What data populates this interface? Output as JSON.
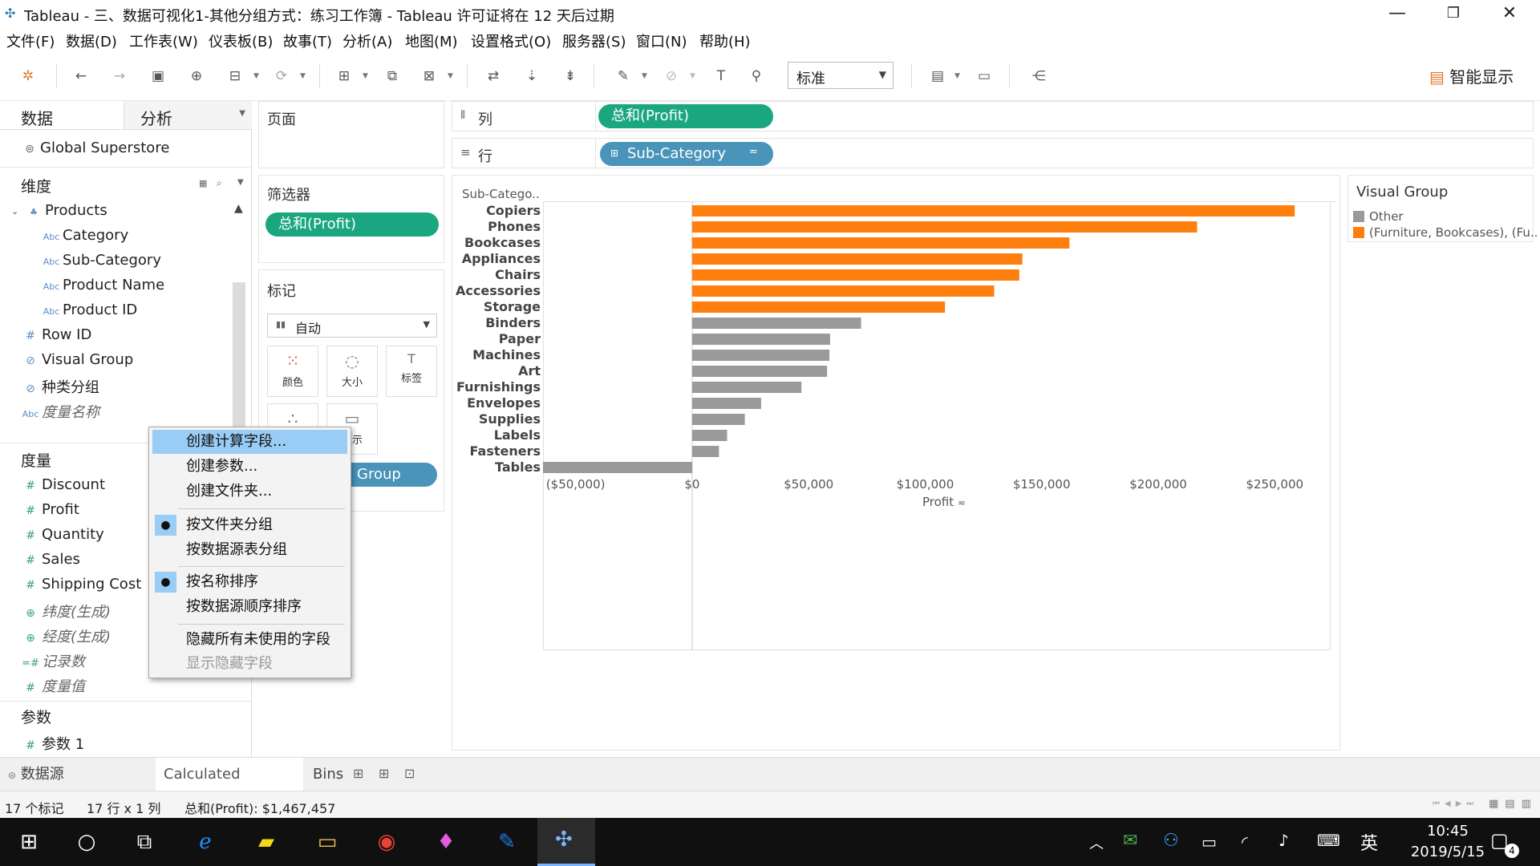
{
  "window": {
    "title": "Tableau - 三、数据可视化1-其他分组方式：练习工作簿 - Tableau 许可证将在 12 天后过期",
    "minimize": "—",
    "maximize": "❐",
    "close": "✕"
  },
  "menu": [
    "文件(F)",
    "数据(D)",
    "工作表(W)",
    "仪表板(B)",
    "故事(T)",
    "分析(A)",
    "地图(M)",
    "设置格式(O)",
    "服务器(S)",
    "窗口(N)",
    "帮助(H)"
  ],
  "toolbar": {
    "fit_value": "标准",
    "show_me": "智能显示"
  },
  "data_pane": {
    "tab_data": "数据",
    "tab_analysis": "分析",
    "datasource": "Global Superstore",
    "dimensions_header": "维度",
    "dimensions": [
      {
        "label": "Products",
        "icon": "hierarchy-icon"
      },
      {
        "label": "Category",
        "icon": "Abc"
      },
      {
        "label": "Sub-Category",
        "icon": "Abc"
      },
      {
        "label": "Product Name",
        "icon": "Abc"
      },
      {
        "label": "Product ID",
        "icon": "Abc"
      },
      {
        "label": "Row ID",
        "icon": "#"
      },
      {
        "label": "Visual Group",
        "icon": "paperclip-icon"
      },
      {
        "label": "种类分组",
        "icon": "paperclip-icon"
      },
      {
        "label": "度量名称",
        "icon": "Abc"
      }
    ],
    "measures_header": "度量",
    "measures": [
      {
        "label": "Discount",
        "icon": "#"
      },
      {
        "label": "Profit",
        "icon": "#"
      },
      {
        "label": "Quantity",
        "icon": "#"
      },
      {
        "label": "Sales",
        "icon": "#"
      },
      {
        "label": "Shipping Cost",
        "icon": "#"
      },
      {
        "label": "纬度(生成)",
        "icon": "globe-icon"
      },
      {
        "label": "经度(生成)",
        "icon": "globe-icon"
      },
      {
        "label": "记录数",
        "icon": "=#"
      },
      {
        "label": "度量值",
        "icon": "#"
      }
    ],
    "params_header": "参数",
    "params": [
      {
        "label": "参数 1",
        "icon": "#"
      }
    ]
  },
  "shelves": {
    "pages": "页面",
    "filters": "筛选器",
    "filter_pill": "总和(Profit)",
    "marks": "标记",
    "mark_type": "自动",
    "mark_color": "颜色",
    "mark_size": "大小",
    "mark_label": "标签",
    "mark_tooltip": "提示",
    "color_pill": "Group",
    "columns": "列",
    "columns_pill": "总和(Profit)",
    "rows": "行",
    "rows_pill": "Sub-Category"
  },
  "legend": {
    "title": "Visual Group",
    "items": [
      {
        "label": "Other",
        "color": "#9a9a9a"
      },
      {
        "label": "(Furniture, Bookcases), (Fu..",
        "color": "#ff7f0e"
      }
    ]
  },
  "chart_data": {
    "type": "bar",
    "orientation": "horizontal",
    "row_header": "Sub-Catego..",
    "xlabel": "Profit",
    "xlim": [
      -64000,
      274000
    ],
    "xticks": [
      -50000,
      0,
      50000,
      100000,
      150000,
      200000,
      250000
    ],
    "xtick_labels": [
      "($50,000)",
      "$0",
      "$50,000",
      "$100,000",
      "$150,000",
      "$200,000",
      "$250,000"
    ],
    "categories": [
      "Copiers",
      "Phones",
      "Bookcases",
      "Appliances",
      "Chairs",
      "Accessories",
      "Storage",
      "Binders",
      "Paper",
      "Machines",
      "Art",
      "Furnishings",
      "Envelopes",
      "Supplies",
      "Labels",
      "Fasteners",
      "Tables"
    ],
    "values": [
      258600,
      216700,
      161900,
      141700,
      140400,
      129600,
      108500,
      72500,
      59200,
      58900,
      57900,
      46900,
      29600,
      22600,
      15000,
      11500,
      -64100
    ],
    "groups": [
      "highlight",
      "highlight",
      "highlight",
      "highlight",
      "highlight",
      "highlight",
      "highlight",
      "other",
      "other",
      "other",
      "other",
      "other",
      "other",
      "other",
      "other",
      "other",
      "other"
    ],
    "colors": {
      "highlight": "#ff7f0e",
      "other": "#9a9a9a"
    },
    "grid": false
  },
  "context_menu": {
    "items": [
      {
        "label": "创建计算字段...",
        "state": "highlighted"
      },
      {
        "label": "创建参数...",
        "state": "normal"
      },
      {
        "label": "创建文件夹...",
        "state": "normal"
      },
      {
        "label": "按文件夹分组",
        "state": "checked"
      },
      {
        "label": "按数据源表分组",
        "state": "normal"
      },
      {
        "label": "按名称排序",
        "state": "checked"
      },
      {
        "label": "按数据源顺序排序",
        "state": "normal"
      },
      {
        "label": "隐藏所有未使用的字段",
        "state": "normal"
      },
      {
        "label": "显示隐藏字段",
        "state": "disabled"
      }
    ]
  },
  "tabs": {
    "datasource": "数据源",
    "sheet1": "Calculated Groups",
    "sheet2": "Bins"
  },
  "status": {
    "marks": "17 个标记",
    "rows_cols": "17 行 x 1 列",
    "sum": "总和(Profit): $1,467,457"
  },
  "taskbar": {
    "ime": "英",
    "time": "10:45",
    "date": "2019/5/15",
    "notif_count": "4"
  }
}
